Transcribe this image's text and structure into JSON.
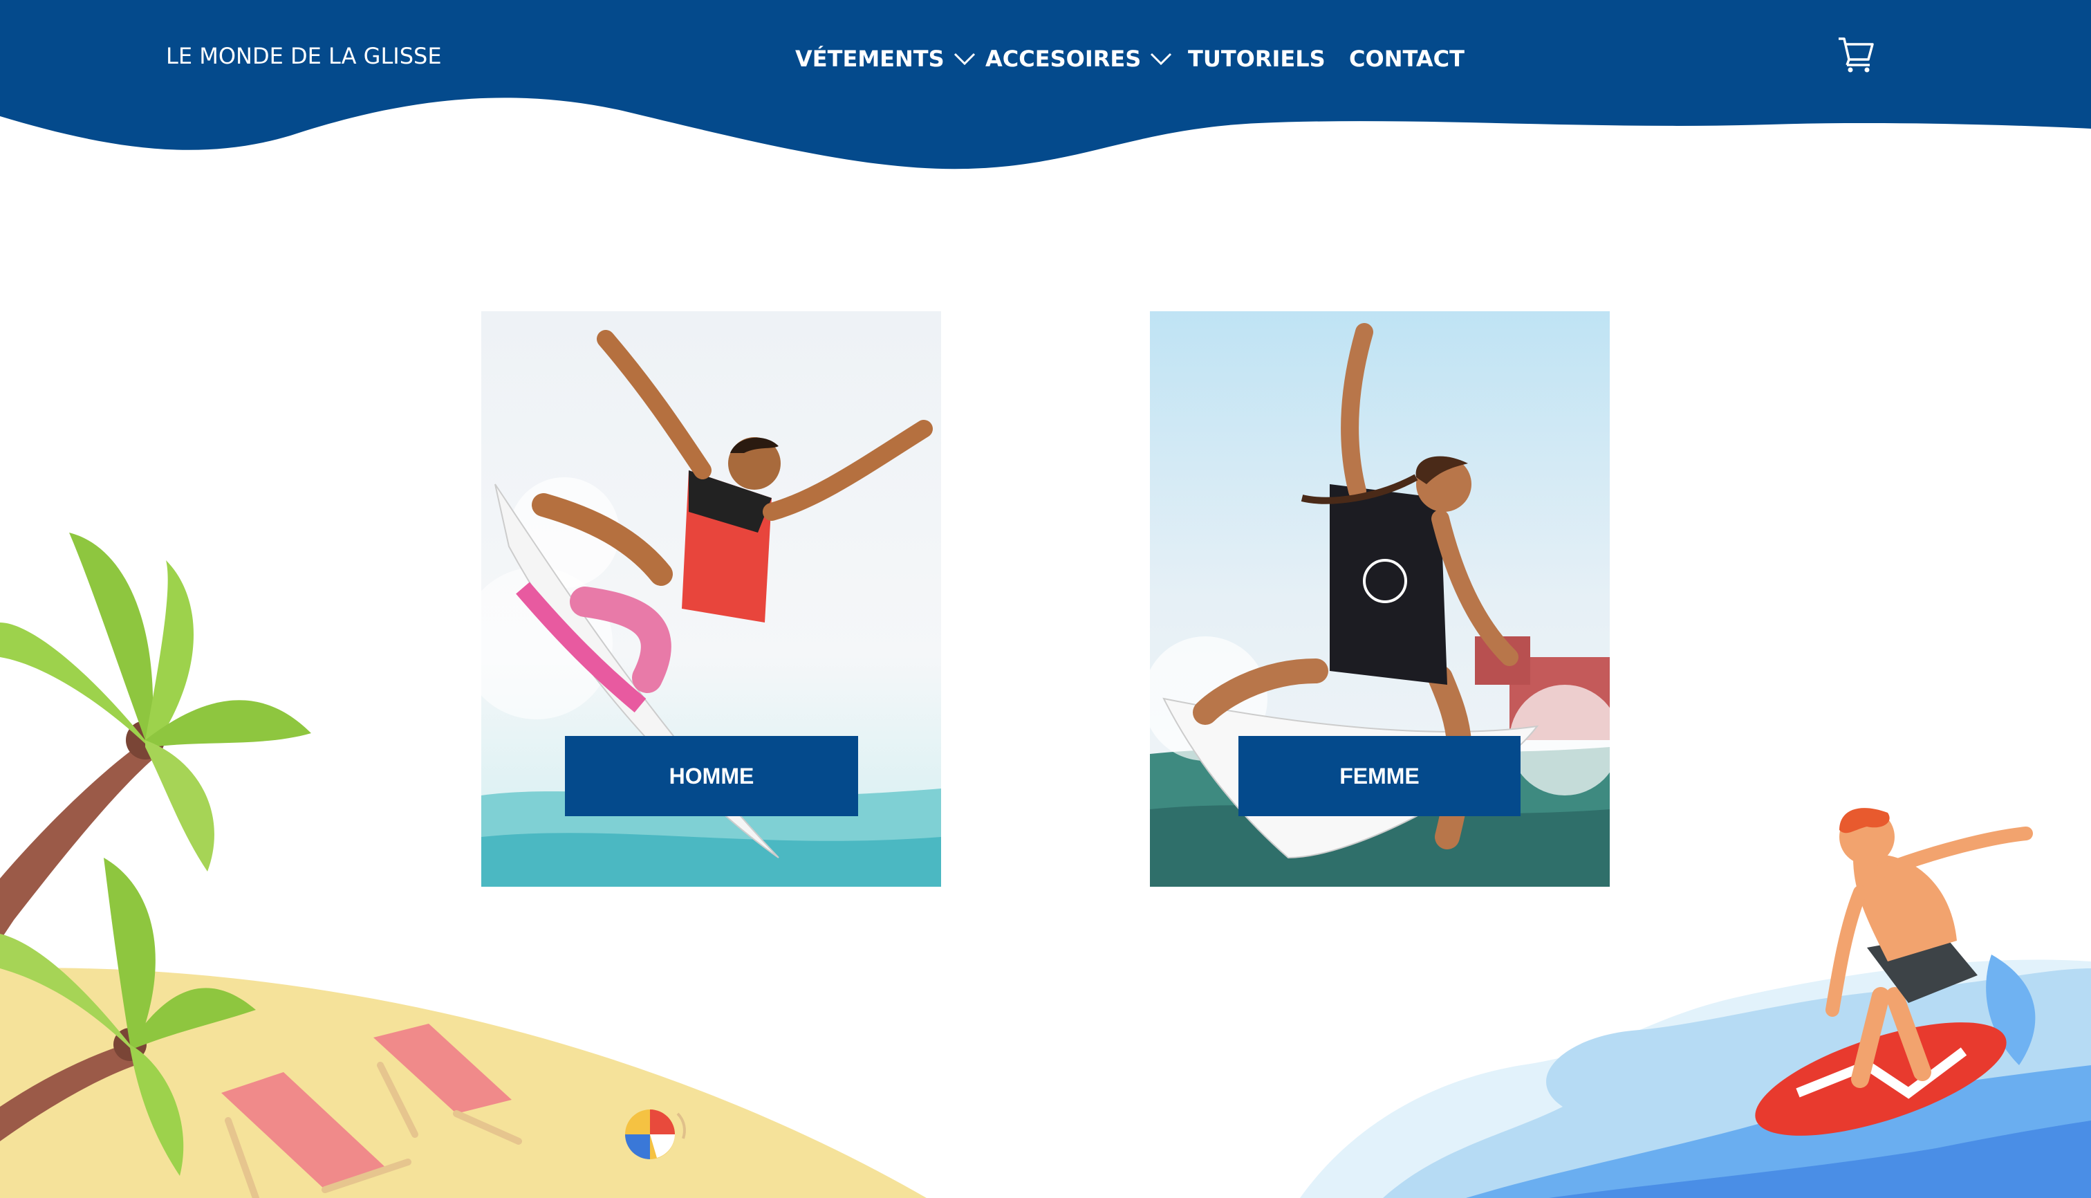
{
  "colors": {
    "brand_blue": "#044a8c",
    "sand": "#f5e29a",
    "palm_green": "#8ec63f",
    "trunk": "#8a5544",
    "chair": "#f08080",
    "water_light": "#a8d8f0",
    "water_mid": "#5aa8e6",
    "water_dark": "#3b82e0"
  },
  "header": {
    "logo": "LE MONDE DE LA GLISSE",
    "nav": [
      {
        "label": "VÉTEMENTS",
        "icon": "chevron-down-icon"
      },
      {
        "label": "ACCESOIRES",
        "icon": "chevron-down-icon"
      },
      {
        "label": "TUTORIELS"
      },
      {
        "label": "CONTACT"
      }
    ],
    "cart_icon": "shopping-cart-icon"
  },
  "categories": [
    {
      "label": "HOMME",
      "image": "male-surfer-photo"
    },
    {
      "label": "FEMME",
      "image": "female-surfer-photo"
    }
  ],
  "decorations": [
    "palm-tree-illustration",
    "beach-chair-illustration",
    "beach-ball-illustration",
    "surfer-illustration"
  ]
}
